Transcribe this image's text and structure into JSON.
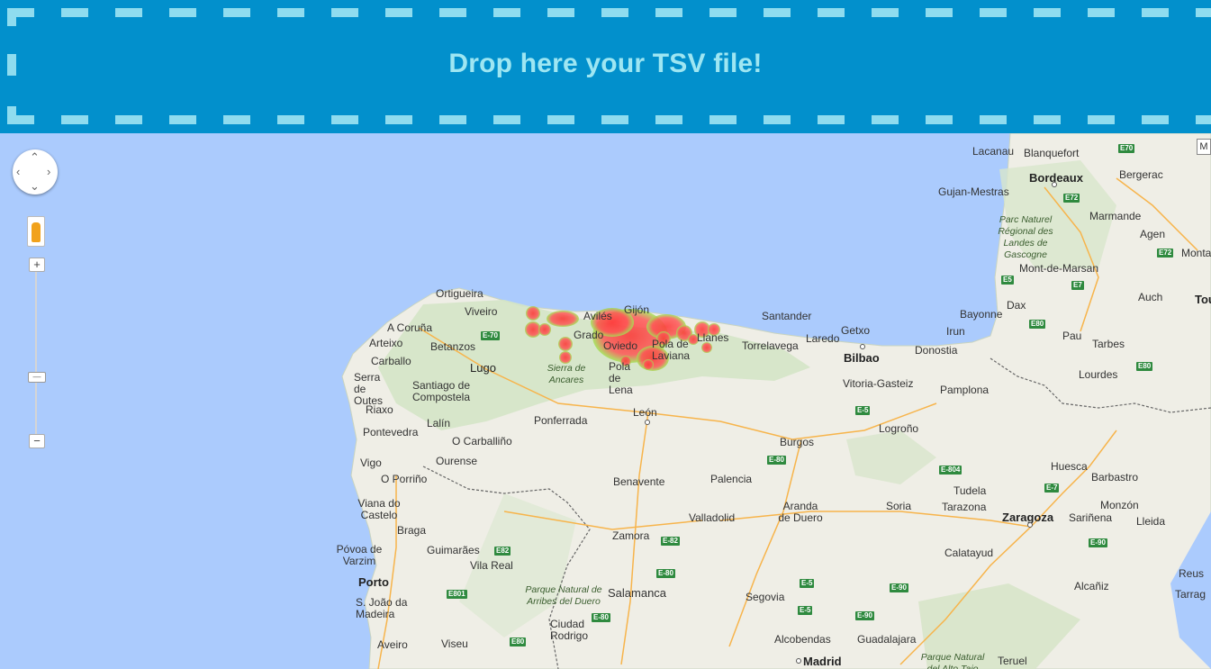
{
  "dropzone": {
    "title": "Drop here your TSV file!"
  },
  "controls": {
    "pan_label": "",
    "zoom_in": "+",
    "zoom_out": "−",
    "zoom_slider_mark": "—",
    "map_type": "M"
  },
  "map": {
    "cities": {
      "lacanau": "Lacanau",
      "blanquefort": "Blanquefort",
      "e70": "E70",
      "bordeaux": "Bordeaux",
      "bergerac": "Bergerac",
      "gujan": "Gujan-Mestras",
      "e72a": "E72",
      "parc_landes": "Parc Naturel Régional des Landes de Gascogne",
      "marmande": "Marmande",
      "agen": "Agen",
      "monta": "Monta",
      "e72b": "E72",
      "mont_marsan": "Mont-de-Marsan",
      "e5a": "E5",
      "e7a": "E7",
      "auch": "Auch",
      "tou": "Tou",
      "dax": "Dax",
      "bayonne": "Bayonne",
      "e80a": "E80",
      "pau": "Pau",
      "tarbes": "Tarbes",
      "irun": "Irun",
      "lourdes": "Lourdes",
      "e80b": "E80",
      "ortigueira": "Ortigueira",
      "viveiro": "Viveiro",
      "acoruna": "A Coruña",
      "e70b": "E-70",
      "arteixo": "Arteixo",
      "betanzos": "Betanzos",
      "carballo": "Carballo",
      "lugo": "Lugo",
      "serra_outes": "Serra de Outes",
      "santiago": "Santiago de Compostela",
      "riaxo": "Riaxo",
      "lalin": "Lalín",
      "pontevedra": "Pontevedra",
      "ocarballino": "O Carballiño",
      "vigo": "Vigo",
      "ourense": "Ourense",
      "oporrino": "O Porriño",
      "sierra_ancares": "Sierra de Ancares",
      "ponferrada": "Ponferrada",
      "aviles": "Avilés",
      "gijon": "Gijón",
      "grado": "Grado",
      "oviedo": "Oviedo",
      "pola_laviana": "Pola de Laviana",
      "pola_lena": "Pola de Lena",
      "llanes": "Llanes",
      "santander": "Santander",
      "torrelavega": "Torrelavega",
      "laredo": "Laredo",
      "getxo": "Getxo",
      "bilbao": "Bilbao",
      "donostia": "Donostia",
      "vitoria": "Vitoria-Gasteiz",
      "pamplona": "Pamplona",
      "e5b": "E-5",
      "leon": "León",
      "burgos": "Burgos",
      "logrono": "Logroño",
      "e80c": "E-80",
      "e804": "E-804",
      "huesca": "Huesca",
      "barbastro": "Barbastro",
      "e7b": "E-7",
      "tudela": "Tudela",
      "benavente": "Benavente",
      "palencia": "Palencia",
      "aranda": "Aranda de Duero",
      "soria": "Soria",
      "tarazona": "Tarazona",
      "zaragoza": "Zaragoza",
      "monzon": "Monzón",
      "lleida": "Lleida",
      "sarinena": "Sariñena",
      "valladolid": "Valladolid",
      "viana": "Viana do Castelo",
      "braga": "Braga",
      "zamora": "Zamora",
      "e82a": "E-82",
      "e82b": "E82",
      "guimaraes": "Guimarães",
      "povoa": "Póvoa de Varzim",
      "vilareal": "Vila Real",
      "porto": "Porto",
      "sjoao": "S. João da Madeira",
      "e801": "E801",
      "e80d": "E-80",
      "parque_arribes": "Parque Natural de Arribes del Duero",
      "salamanca": "Salamanca",
      "e5c": "E-5",
      "e90a": "E-90",
      "calatayud": "Calatayud",
      "e90b": "E-90",
      "segovia": "Segovia",
      "e5d": "E-5",
      "e90c": "E-90",
      "alcaniz": "Alcañiz",
      "reus": "Reus",
      "tarrag": "Tarrag",
      "ciudad_rodrigo": "Ciudad Rodrigo",
      "e80e": "E-80",
      "aveiro": "Aveiro",
      "viseu": "Viseu",
      "e80f": "E80",
      "alcobendas": "Alcobendas",
      "guadalajara": "Guadalajara",
      "madrid": "Madrid",
      "parque_tajo": "Parque Natural del Alto Tajo",
      "teruel": "Teruel"
    }
  }
}
